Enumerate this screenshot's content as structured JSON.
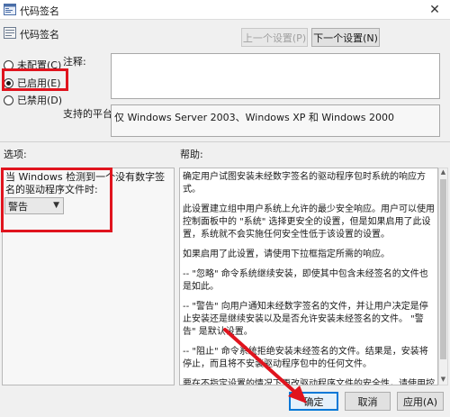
{
  "window": {
    "title": "代码签名",
    "close_glyph": "✕"
  },
  "header": {
    "policy_name": "代码签名",
    "prev_label": "上一个设置(P)",
    "next_label": "下一个设置(N)"
  },
  "radios": [
    {
      "label": "未配置(C)",
      "checked": false
    },
    {
      "label": "已启用(E)",
      "checked": true
    },
    {
      "label": "已禁用(D)",
      "checked": false
    }
  ],
  "comment": {
    "label": "注释:",
    "value": ""
  },
  "supported": {
    "label": "支持的平台:",
    "value": "仅 Windows Server 2003、Windows XP 和 Windows 2000"
  },
  "options": {
    "section_label": "选项:",
    "text": "当 Windows 检测到一个没有数字签名的驱动程序文件时:",
    "selected": "警告"
  },
  "help": {
    "section_label": "帮助:",
    "paragraphs": [
      "确定用户试图安装未经数字签名的驱动程序包时系统的响应方式。",
      "此设置建立组中用户系统上允许的最少安全响应。用户可以使用控制面板中的 \"系统\" 选择更安全的设置，但是如果启用了此设置，系统就不会实施任何安全性低于该设置的设置。",
      "如果启用了此设置，请使用下拉框指定所需的响应。",
      "-- \"忽略\" 命令系统继续安装，即使其中包含未经签名的文件也是如此。",
      "-- \"警告\" 向用户通知未经数字签名的文件，并让用户决定是停止安装还是继续安装以及是否允许安装未经签名的文件。 \"警告\" 是默认设置。",
      "-- \"阻止\" 命令系统拒绝安装未经签名的文件。结果是，安装将停止，而且将不安装驱动程序包中的任何文件。",
      "要在不指定设置的情况下更改驱动程序文件的安全性，请使用控制面板中的 \"系统\"。右键单击 \"我的电脑\"，单击 \"属性\"，单击 \"硬件\" 选项卡，然后单击 \"驱动程序签名\" 按钮。"
    ]
  },
  "footer": {
    "ok_label": "确定",
    "cancel_label": "取消",
    "apply_label": "应用(A)"
  },
  "colors": {
    "highlight": "#e0141e",
    "accent": "#0078d7"
  }
}
